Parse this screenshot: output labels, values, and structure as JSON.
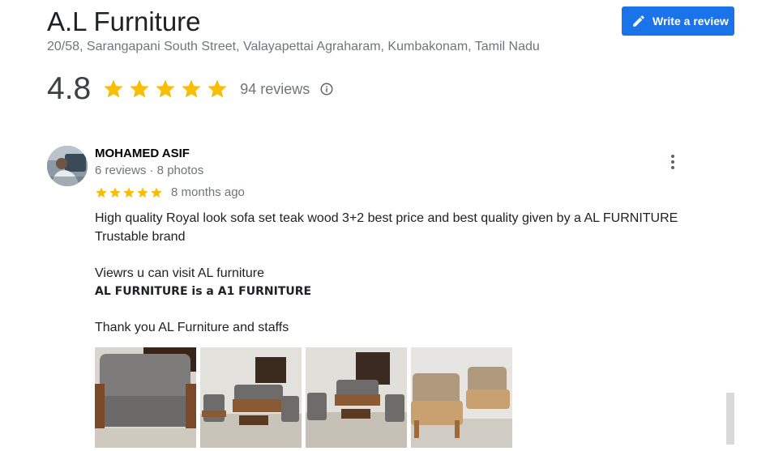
{
  "header": {
    "title": "A.L Furniture",
    "address": "20/58, Sarangapani South Street, Valayapettai Agraharam, Kumbakonam, Tamil Nadu",
    "write_review_label": "Write a review",
    "write_review_icon": "pencil-icon",
    "rating": "4.8",
    "stars": 5,
    "review_count_label": "94 reviews",
    "info_icon": "info-icon"
  },
  "review": {
    "name": "MOHAMED ASIF",
    "meta": "6 reviews · 8 photos",
    "stars": 5,
    "time": "8 months ago",
    "lines": [
      "High quality Royal look sofa set teak wood 3+2 best price and best quality given by a AL FURNITURE",
      "Trustable brand",
      "Viewrs u can visit AL furniture",
      "AL FURNITURE is a A1 FURNITURE",
      "Thank you AL Furniture and staffs"
    ],
    "more_icon": "more-vert-icon"
  },
  "photos": [
    {
      "name": "sofa-closeup-photo"
    },
    {
      "name": "sofa-set-room-photo"
    },
    {
      "name": "sofa-set-window-photo"
    },
    {
      "name": "sofa-set-angle-photo"
    }
  ],
  "colors": {
    "accent": "#1a73e8",
    "star": "#fbbc04",
    "muted": "#70757a"
  }
}
